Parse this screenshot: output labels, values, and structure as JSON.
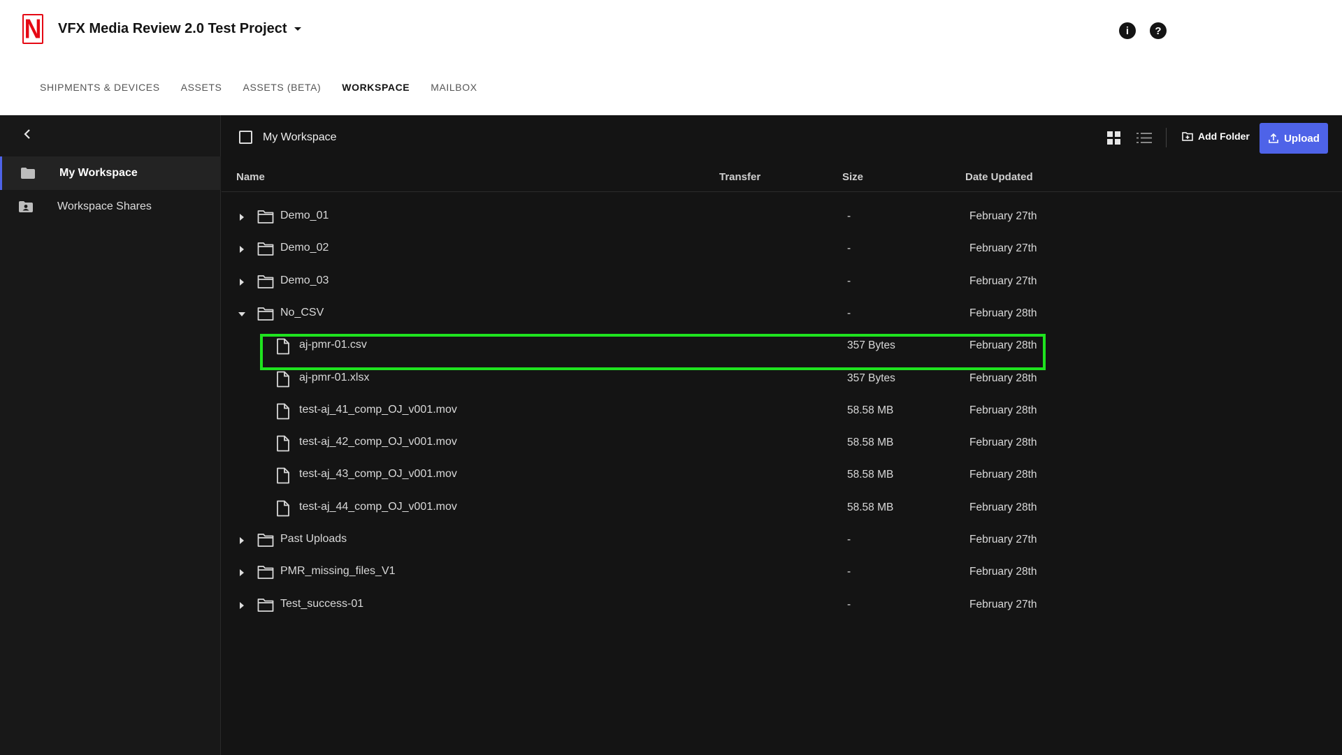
{
  "header": {
    "project_title": "VFX Media Review 2.0 Test Project",
    "logo_letter": "N",
    "info_icon": "info-icon",
    "help_icon": "help-icon",
    "nav": [
      {
        "label": "SHIPMENTS & DEVICES",
        "active": false
      },
      {
        "label": "ASSETS",
        "active": false
      },
      {
        "label": "ASSETS (BETA)",
        "active": false
      },
      {
        "label": "WORKSPACE",
        "active": true
      },
      {
        "label": "MAILBOX",
        "active": false
      }
    ]
  },
  "sidebar": {
    "items": [
      {
        "label": "My Workspace",
        "icon": "folder-icon",
        "active": true
      },
      {
        "label": "Workspace Shares",
        "icon": "shared-folder-icon",
        "active": false
      }
    ]
  },
  "toolbar": {
    "breadcrumb": "My Workspace",
    "add_folder_label": "Add Folder",
    "upload_label": "Upload",
    "accent_color": "#4e63e8"
  },
  "table": {
    "columns": {
      "name": "Name",
      "transfer": "Transfer",
      "size": "Size",
      "date": "Date Updated"
    },
    "rows": [
      {
        "name": "Demo_01",
        "type": "folder",
        "expanded": false,
        "level": 0,
        "size": "-",
        "date": "February 27th"
      },
      {
        "name": "Demo_02",
        "type": "folder",
        "expanded": false,
        "level": 0,
        "size": "-",
        "date": "February 27th"
      },
      {
        "name": "Demo_03",
        "type": "folder",
        "expanded": false,
        "level": 0,
        "size": "-",
        "date": "February 27th"
      },
      {
        "name": "No_CSV",
        "type": "folder",
        "expanded": true,
        "level": 0,
        "size": "-",
        "date": "February 28th"
      },
      {
        "name": "aj-pmr-01.csv",
        "type": "file",
        "level": 1,
        "size": "357 Bytes",
        "date": "February 28th",
        "highlighted": true
      },
      {
        "name": "aj-pmr-01.xlsx",
        "type": "file",
        "level": 1,
        "size": "357 Bytes",
        "date": "February 28th"
      },
      {
        "name": "test-aj_41_comp_OJ_v001.mov",
        "type": "file",
        "level": 1,
        "size": "58.58 MB",
        "date": "February 28th"
      },
      {
        "name": "test-aj_42_comp_OJ_v001.mov",
        "type": "file",
        "level": 1,
        "size": "58.58 MB",
        "date": "February 28th"
      },
      {
        "name": "test-aj_43_comp_OJ_v001.mov",
        "type": "file",
        "level": 1,
        "size": "58.58 MB",
        "date": "February 28th"
      },
      {
        "name": "test-aj_44_comp_OJ_v001.mov",
        "type": "file",
        "level": 1,
        "size": "58.58 MB",
        "date": "February 28th"
      },
      {
        "name": "Past Uploads",
        "type": "folder",
        "expanded": false,
        "level": 0,
        "size": "-",
        "date": "February 27th"
      },
      {
        "name": "PMR_missing_files_V1",
        "type": "folder",
        "expanded": false,
        "level": 0,
        "size": "-",
        "date": "February 28th"
      },
      {
        "name": "Test_success-01",
        "type": "folder",
        "expanded": false,
        "level": 0,
        "size": "-",
        "date": "February 27th"
      }
    ],
    "highlight_color": "#1fe31f"
  }
}
